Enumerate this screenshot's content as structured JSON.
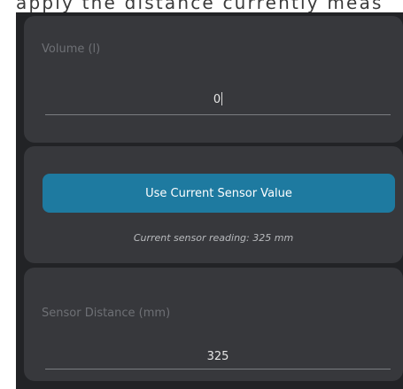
{
  "header_snippet": "apply the distance currently meas",
  "volume": {
    "label": "Volume (l)",
    "value": "0"
  },
  "sensor": {
    "button_label": "Use Current Sensor Value",
    "reading_text": "Current sensor reading: 325 mm"
  },
  "distance": {
    "label": "Sensor Distance (mm)",
    "value": "325"
  },
  "colors": {
    "background": "#222326",
    "card": "#37383c",
    "accent": "#1e7aa0"
  }
}
